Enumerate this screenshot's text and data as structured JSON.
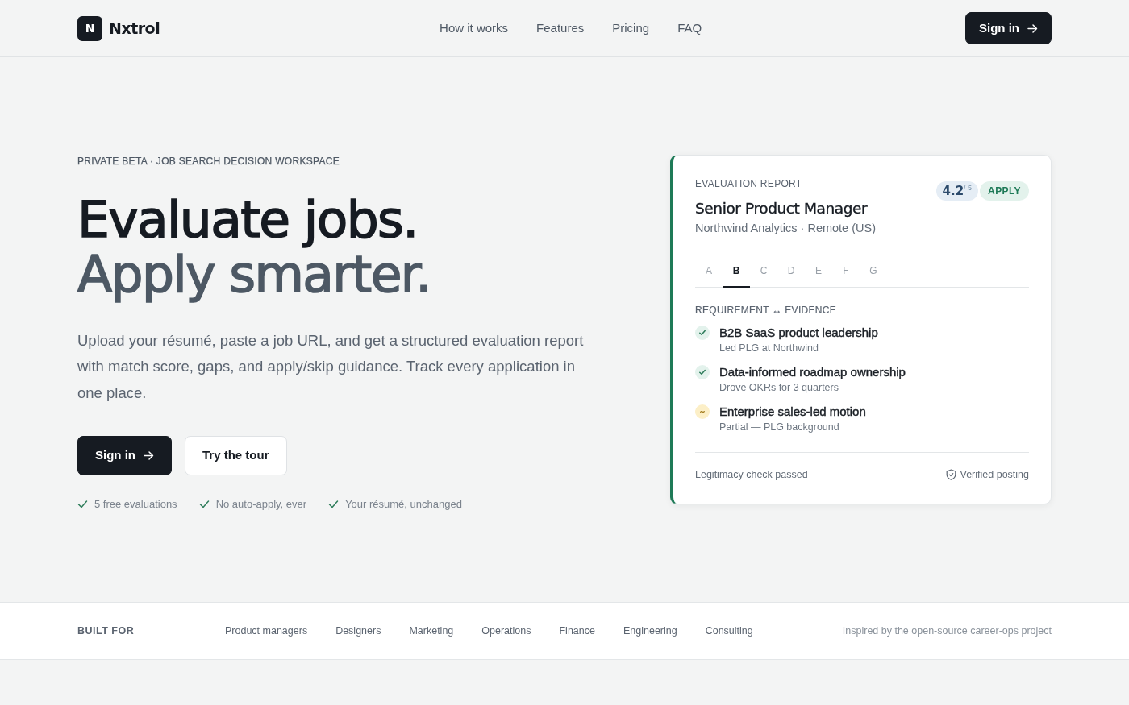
{
  "header": {
    "logo": {
      "mark": "N",
      "name": "Nxtrol"
    },
    "nav": [
      "How it works",
      "Features",
      "Pricing",
      "FAQ"
    ],
    "sign_in": "Sign in"
  },
  "hero": {
    "eyebrow": "PRIVATE BETA · JOB SEARCH DECISION WORKSPACE",
    "headline": [
      "Evaluate jobs.",
      "Apply smarter."
    ],
    "lead": "Upload your résumé, paste a job URL, and get a structured evaluation report with match score, gaps, and apply/skip guidance. Track every application in one place.",
    "buttons": [
      {
        "label": "Sign in",
        "kind": "primary"
      },
      {
        "label": "Try the tour",
        "kind": "secondary"
      }
    ],
    "perks": [
      "5 free evaluations",
      "No auto-apply, ever",
      "Your résumé, unchanged"
    ]
  },
  "report": {
    "eyebrow": "EVALUATION REPORT",
    "title": "Senior Product Manager",
    "subtitle": "Northwind Analytics · Remote (US)",
    "score": "4.2$^{/ 5}$",
    "verdict": "APPLY",
    "tabs": [
      {
        "label": "A",
        "selected": false
      },
      {
        "label": "B",
        "selected": true
      },
      {
        "label": "C",
        "selected": false
      },
      {
        "label": "D",
        "selected": false
      },
      {
        "label": "E",
        "selected": false
      },
      {
        "label": "F",
        "selected": false
      },
      {
        "label": "G",
        "selected": false
      }
    ],
    "section_label": "REQUIREMENT ↔ EVIDENCE",
    "requirements": [
      {
        "kind": "met",
        "title": "B2B SaaS product leadership",
        "evidence": "Led PLG at Northwind"
      },
      {
        "kind": "met",
        "title": "Data-informed roadmap ownership",
        "evidence": "Drove OKRs for 3 quarters"
      },
      {
        "kind": "partial",
        "title": "Enterprise sales-led motion",
        "evidence": "Partial — PLG background"
      }
    ],
    "footer_left": "Legitimacy check passed",
    "footer_right": "Verified posting"
  },
  "built_for": {
    "label": "BUILT FOR",
    "roles": [
      "Product managers",
      "Designers",
      "Marketing",
      "Operations",
      "Finance",
      "Engineering",
      "Consulting"
    ],
    "note": "Inspired by the open-source career-ops project"
  }
}
